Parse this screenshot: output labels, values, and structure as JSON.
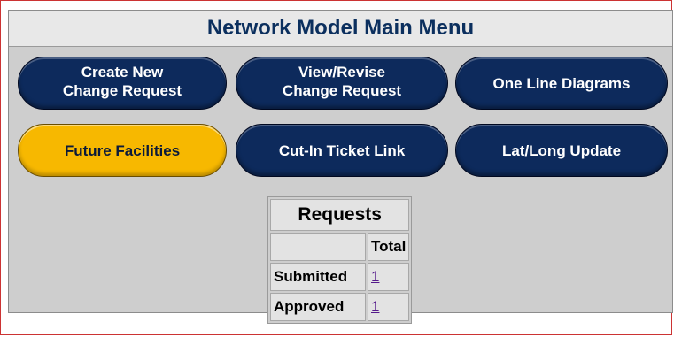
{
  "menu": {
    "title": "Network Model Main Menu",
    "buttons": [
      {
        "label": "Create New\nChange Request"
      },
      {
        "label": "View/Revise\nChange Request"
      },
      {
        "label": "One Line Diagrams"
      },
      {
        "label": "Future Facilities",
        "active": true
      },
      {
        "label": "Cut-In Ticket Link"
      },
      {
        "label": "Lat/Long Update"
      }
    ]
  },
  "requests": {
    "caption": "Requests",
    "column_header": "Total",
    "rows": [
      {
        "label": "Submitted",
        "total": "1"
      },
      {
        "label": "Approved",
        "total": "1"
      }
    ]
  },
  "colors": {
    "button_navy": "#0d2a5c",
    "button_active": "#f7b800",
    "title_text": "#0b2f5e"
  }
}
